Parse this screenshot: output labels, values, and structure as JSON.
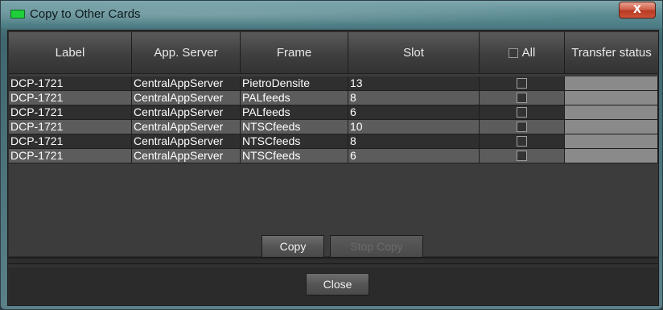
{
  "window": {
    "title": "Copy to Other Cards",
    "close_glyph": "X"
  },
  "table": {
    "columns": [
      "Label",
      "App. Server",
      "Frame",
      "Slot",
      "All",
      "Transfer status"
    ],
    "rows": [
      {
        "label": "DCP-1721",
        "server": "CentralAppServer",
        "frame": "PietroDensite",
        "slot": "13",
        "status": ""
      },
      {
        "label": "DCP-1721",
        "server": "CentralAppServer",
        "frame": "PALfeeds",
        "slot": "8",
        "status": ""
      },
      {
        "label": "DCP-1721",
        "server": "CentralAppServer",
        "frame": "PALfeeds",
        "slot": "6",
        "status": ""
      },
      {
        "label": "DCP-1721",
        "server": "CentralAppServer",
        "frame": "NTSCfeeds",
        "slot": "10",
        "status": ""
      },
      {
        "label": "DCP-1721",
        "server": "CentralAppServer",
        "frame": "NTSCfeeds",
        "slot": "8",
        "status": ""
      },
      {
        "label": "DCP-1721",
        "server": "CentralAppServer",
        "frame": "NTSCfeeds",
        "slot": "6",
        "status": ""
      }
    ]
  },
  "buttons": {
    "copy": "Copy",
    "stop_copy": "Stop Copy",
    "close": "Close"
  },
  "colors": {
    "title_icon": "#1fcf3a",
    "close_button": "#c9533a"
  }
}
